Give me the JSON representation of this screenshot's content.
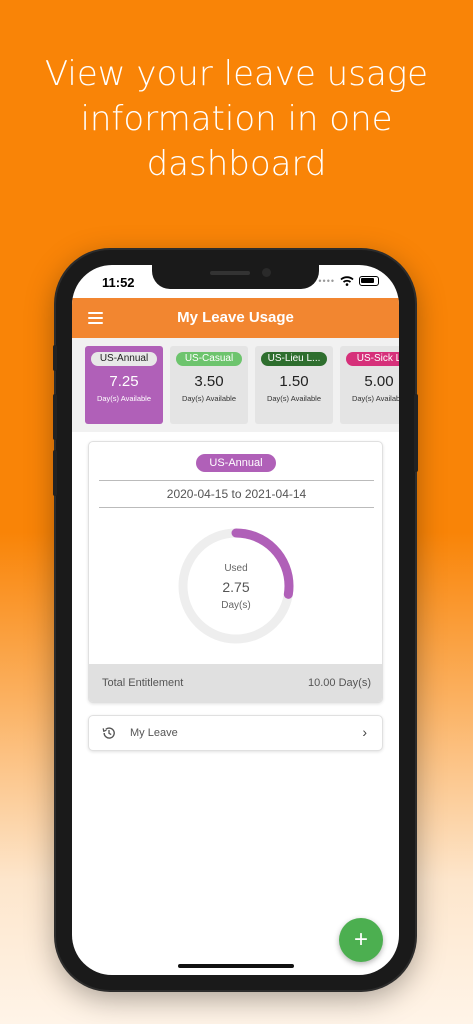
{
  "headline": [
    "View your leave usage",
    "information in one",
    "dashboard"
  ],
  "status": {
    "time": "11:52",
    "signal_icon": "signal-dots-icon",
    "wifi_icon": "wifi-icon",
    "battery_icon": "battery-icon"
  },
  "appbar": {
    "title": "My Leave Usage",
    "menu_icon": "hamburger-menu-icon"
  },
  "leave_cards": [
    {
      "label": "US-Annual",
      "value": "7.25",
      "sub": "Day(s) Available",
      "pill_color": "#e8e8e8",
      "pill_text_color": "#222",
      "active": true
    },
    {
      "label": "US-Casual",
      "value": "3.50",
      "sub": "Day(s) Available",
      "pill_color": "#6dc46d",
      "pill_text_color": "#fff",
      "active": false
    },
    {
      "label": "US-Lieu L...",
      "value": "1.50",
      "sub": "Day(s) Available",
      "pill_color": "#2e6e2e",
      "pill_text_color": "#fff",
      "active": false
    },
    {
      "label": "US-Sick L",
      "value": "5.00",
      "sub": "Day(s) Available",
      "pill_color": "#d6307a",
      "pill_text_color": "#fff",
      "active": false
    }
  ],
  "detail": {
    "type_label": "US-Annual",
    "date_range": "2020-04-15 to 2021-04-14",
    "used_label": "Used",
    "used_value": "2.75",
    "used_unit": "Day(s)",
    "used_fraction": 0.275,
    "total_label": "Total Entitlement",
    "total_value": "10.00 Day(s)"
  },
  "my_leave": {
    "label": "My Leave",
    "icon": "history-icon",
    "chevron": "›"
  },
  "fab": {
    "label": "+"
  },
  "colors": {
    "brand_orange": "#f98407",
    "appbar": "#f28630",
    "accent_purple": "#b060b8",
    "fab_green": "#4caf50"
  }
}
